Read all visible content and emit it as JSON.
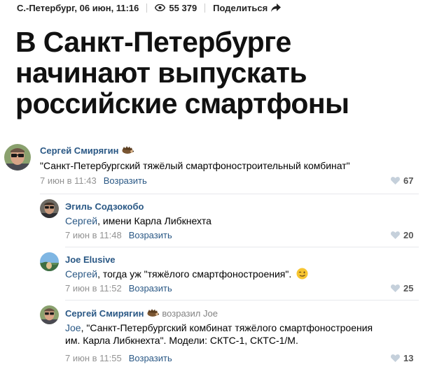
{
  "article": {
    "location_date": "С.-Петербург, 06 июн, 11:16",
    "views": "55 379",
    "share_label": "Поделиться",
    "title_line1": "В Санкт-Петербурге",
    "title_line2": "начинают выпускать",
    "title_line3": "российские смартфоны"
  },
  "comments": [
    {
      "author": "Сергей Смирягин",
      "text": "\"Санкт-Петербургский тяжёлый смартфоностроительный комбинат\"",
      "date": "7 июн в 11:43",
      "reply_label": "Возразить",
      "likes": "67"
    },
    {
      "author": "Эгиль Содзокобо",
      "mention": "Сергей",
      "text": ", имени Карла Либкнехта",
      "date": "7 июн в 11:48",
      "reply_label": "Возразить",
      "likes": "20"
    },
    {
      "author": "Joe Elusive",
      "mention": "Сергей",
      "text": ", тогда уж \"тяжёлого смартфоностроения\".",
      "date": "7 июн в 11:52",
      "reply_label": "Возразить",
      "likes": "25"
    },
    {
      "author": "Сергей Смирягин",
      "replied_to": "возразил Joe",
      "mention": "Joe",
      "text_line1": ", \"Санкт-Петербургский комбинат тяжёлого смартфоностроения",
      "text_line2": "им. Карла Либкнехта\". Модели: СКТС-1, СКТС-1/М.",
      "date": "7 июн в 11:55",
      "reply_label": "Возразить",
      "likes": "13"
    }
  ],
  "icons": {
    "views": "eye-icon",
    "share": "share-arrow-icon",
    "like": "heart-icon",
    "author_badge": "hedgehog-icon",
    "emoji": "winking-face-emoji"
  },
  "colors": {
    "link": "#2a5885",
    "muted": "#939393",
    "title": "#111111"
  }
}
